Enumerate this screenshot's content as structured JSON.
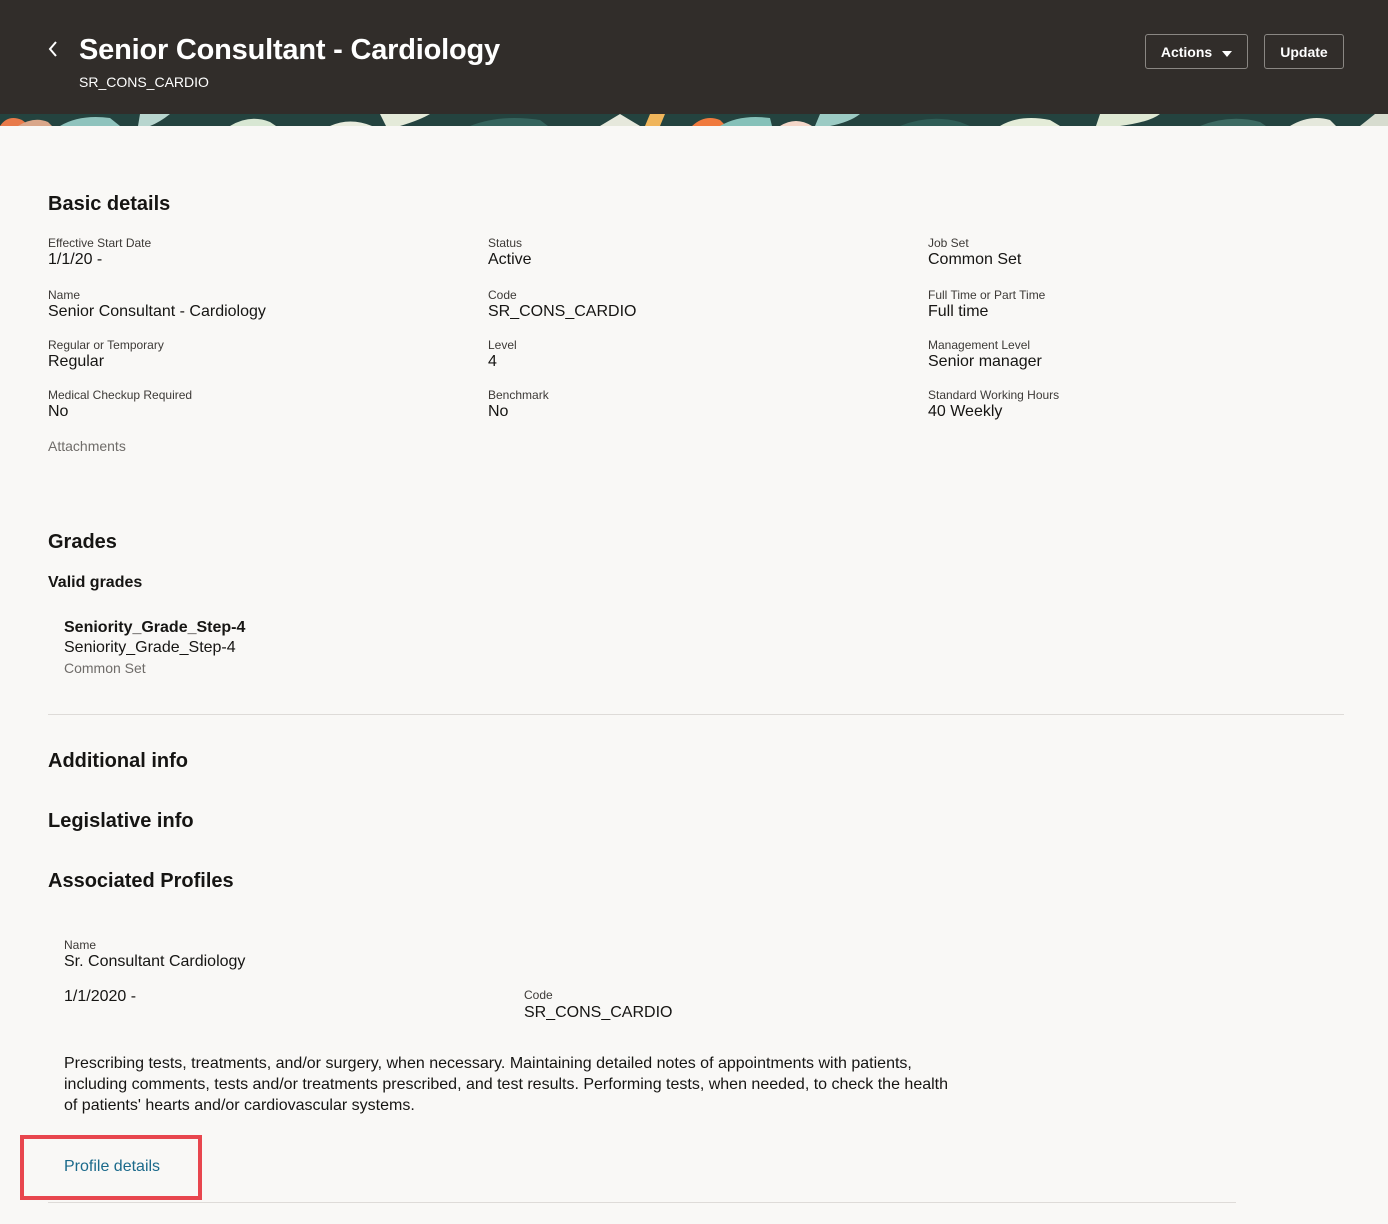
{
  "header": {
    "title": "Senior Consultant - Cardiology",
    "code": "SR_CONS_CARDIO",
    "actions_label": "Actions",
    "update_label": "Update"
  },
  "basic_details": {
    "heading": "Basic details",
    "fields": {
      "effective_start_date": {
        "label": "Effective Start Date",
        "value": "1/1/20 -"
      },
      "status": {
        "label": "Status",
        "value": "Active"
      },
      "job_set": {
        "label": "Job Set",
        "value": "Common Set"
      },
      "name": {
        "label": "Name",
        "value": "Senior Consultant - Cardiology"
      },
      "code": {
        "label": "Code",
        "value": "SR_CONS_CARDIO"
      },
      "full_or_part_time": {
        "label": "Full Time or Part Time",
        "value": "Full time"
      },
      "regular_or_temporary": {
        "label": "Regular or Temporary",
        "value": "Regular"
      },
      "level": {
        "label": "Level",
        "value": "4"
      },
      "management_level": {
        "label": "Management Level",
        "value": "Senior manager"
      },
      "medical_checkup": {
        "label": "Medical Checkup Required",
        "value": "No"
      },
      "benchmark": {
        "label": "Benchmark",
        "value": "No"
      },
      "standard_working_hours": {
        "label": "Standard Working Hours",
        "value": "40 Weekly"
      }
    },
    "attachments_label": "Attachments"
  },
  "grades": {
    "heading": "Grades",
    "subheading": "Valid grades",
    "items": [
      {
        "title": "Seniority_Grade_Step-4",
        "name": "Seniority_Grade_Step-4",
        "set": "Common Set"
      }
    ]
  },
  "sections": {
    "additional_info": "Additional info",
    "legislative_info": "Legislative info",
    "associated_profiles": "Associated Profiles"
  },
  "profile": {
    "name_label": "Name",
    "name_value": "Sr. Consultant Cardiology",
    "date": "1/1/2020 -",
    "code_label": "Code",
    "code_value": "SR_CONS_CARDIO",
    "description": "Prescribing tests, treatments, and/or surgery, when necessary. Maintaining detailed notes of appointments with patients, including comments, tests and/or treatments prescribed, and test results. Performing tests, when needed, to check the health of patients' hearts and/or cardiovascular systems.",
    "details_link": "Profile details"
  },
  "colors": {
    "header_bg": "#312d2a",
    "page_bg": "#f9f8f6",
    "link": "#1b6a8b",
    "highlight": "#e8464e"
  },
  "icons": {
    "back": "chevron-left-icon",
    "dropdown": "caret-down-icon"
  }
}
